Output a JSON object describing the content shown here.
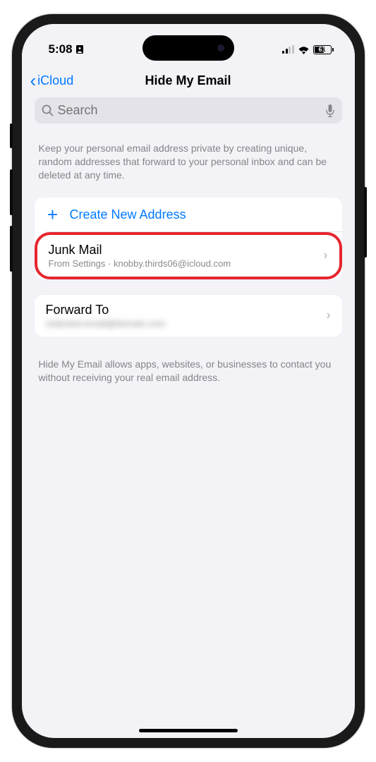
{
  "status": {
    "time": "5:08",
    "battery_pct": "61"
  },
  "nav": {
    "back_label": "iCloud",
    "title": "Hide My Email"
  },
  "search": {
    "placeholder": "Search"
  },
  "intro": "Keep your personal email address private by creating unique, random addresses that forward to your personal inbox and can be deleted at any time.",
  "create_label": "Create New Address",
  "address": {
    "title": "Junk Mail",
    "subtitle": "From Settings · knobby.thirds06@icloud.com"
  },
  "forward": {
    "title": "Forward To",
    "hidden_value": "redacted-email@domain.com"
  },
  "footer": "Hide My Email allows apps, websites, or businesses to contact you without receiving your real email address."
}
